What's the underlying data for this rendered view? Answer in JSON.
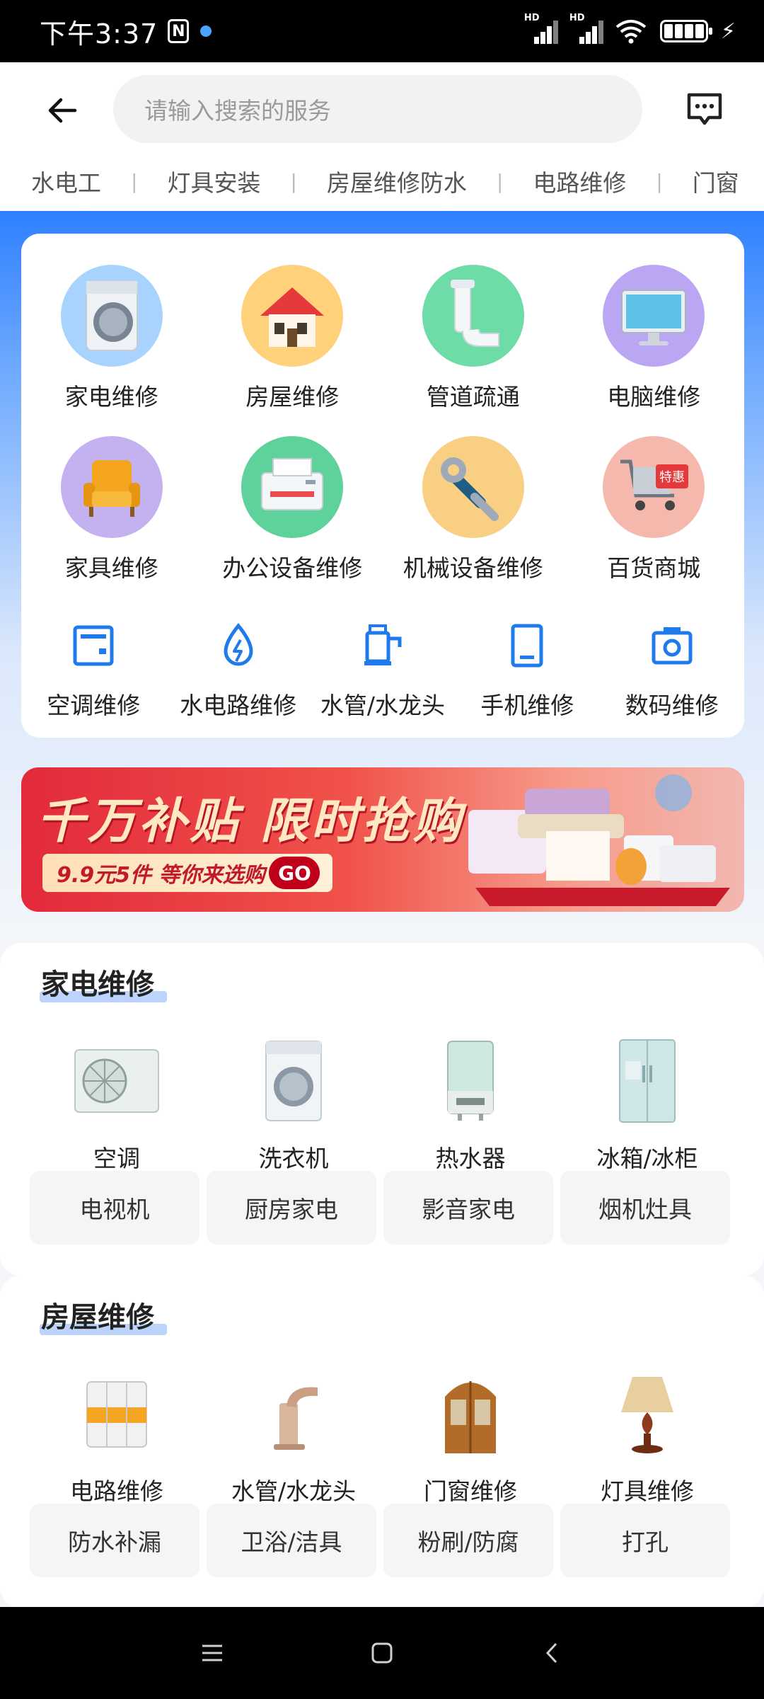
{
  "status_bar": {
    "time": "下午3:37",
    "nfc": "N",
    "network1": "HD",
    "network2": "HD"
  },
  "header": {
    "search_placeholder": "请输入搜索的服务",
    "categories": [
      "水电工",
      "灯具安装",
      "房屋维修防水",
      "电路维修",
      "门窗"
    ]
  },
  "services": {
    "big": [
      {
        "label": "家电维修",
        "icon": "washing-machine-icon"
      },
      {
        "label": "房屋维修",
        "icon": "house-icon"
      },
      {
        "label": "管道疏通",
        "icon": "pipe-icon"
      },
      {
        "label": "电脑维修",
        "icon": "computer-icon"
      },
      {
        "label": "家具维修",
        "icon": "armchair-icon"
      },
      {
        "label": "办公设备维修",
        "icon": "printer-icon"
      },
      {
        "label": "机械设备维修",
        "icon": "wrench-icon"
      },
      {
        "label": "百货商城",
        "icon": "shopping-cart-icon",
        "badge": "特惠"
      }
    ],
    "small": [
      {
        "label": "空调维修",
        "icon": "air-conditioner-icon"
      },
      {
        "label": "水电路维修",
        "icon": "water-electric-icon"
      },
      {
        "label": "水管/水龙头",
        "icon": "faucet-icon"
      },
      {
        "label": "手机维修",
        "icon": "phone-icon"
      },
      {
        "label": "数码维修",
        "icon": "camera-icon"
      }
    ]
  },
  "banner": {
    "title": "千万补贴 限时抢购",
    "subtitle": "9.9元5件 等你来选购",
    "cta": "GO"
  },
  "appliance_section": {
    "title": "家电维修",
    "products": [
      "空调",
      "洗衣机",
      "热水器",
      "冰箱/冰柜"
    ],
    "chips": [
      "电视机",
      "厨房家电",
      "影音家电",
      "烟机灶具"
    ]
  },
  "house_section": {
    "title": "房屋维修",
    "products": [
      "电路维修",
      "水管/水龙头",
      "门窗维修",
      "灯具维修"
    ],
    "chips": [
      "防水补漏",
      "卫浴/洁具",
      "粉刷/防腐",
      "打孔"
    ]
  },
  "colors": {
    "accent": "#2f80ff",
    "icon_blue": "#1f7aec",
    "banner_red": "#e32a3b"
  }
}
